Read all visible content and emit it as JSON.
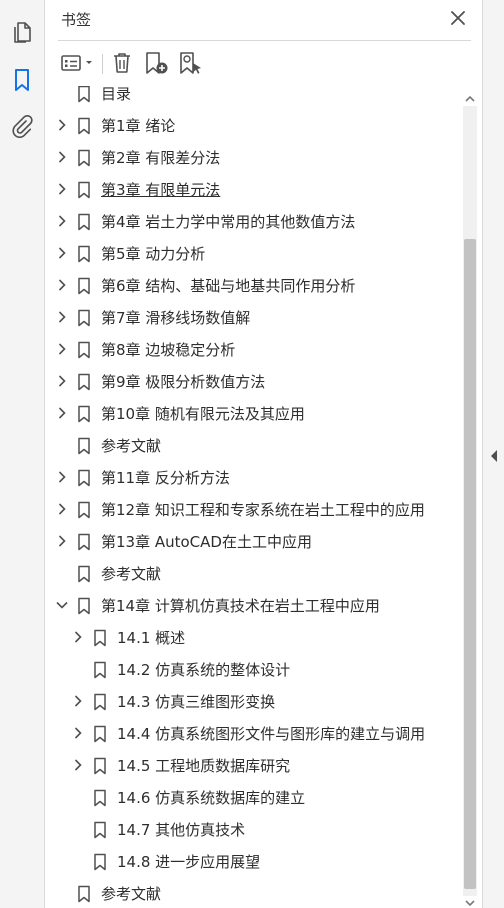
{
  "panel": {
    "title": "书签",
    "close_icon": "close-icon"
  },
  "left_rail": {
    "items": [
      {
        "icon": "pages-icon",
        "active": false
      },
      {
        "icon": "bookmark-icon",
        "active": true
      },
      {
        "icon": "attachment-icon",
        "active": false
      }
    ]
  },
  "toolbar": {
    "options_icon": "list-options-icon",
    "delete_icon": "trash-icon",
    "new_bookmark_icon": "add-bookmark-icon",
    "find_bookmark_icon": "find-bookmark-icon"
  },
  "colors": {
    "accent": "#1473e6",
    "icon_gray": "#505050",
    "scroll_thumb": "#c2c2c2"
  },
  "bookmarks": [
    {
      "label": "目录",
      "level": 0,
      "expander": "none",
      "link": false,
      "partial": true
    },
    {
      "label": "第1章 绪论",
      "level": 0,
      "expander": "collapsed",
      "link": false
    },
    {
      "label": "第2章 有限差分法",
      "level": 0,
      "expander": "collapsed",
      "link": false
    },
    {
      "label": "第3章 有限单元法",
      "level": 0,
      "expander": "collapsed",
      "link": true
    },
    {
      "label": "第4章 岩土力学中常用的其他数值方法",
      "level": 0,
      "expander": "collapsed",
      "link": false
    },
    {
      "label": "第5章 动力分析",
      "level": 0,
      "expander": "collapsed",
      "link": false
    },
    {
      "label": "第6章 结构、基础与地基共同作用分析",
      "level": 0,
      "expander": "collapsed",
      "link": false
    },
    {
      "label": "第7章 滑移线场数值解",
      "level": 0,
      "expander": "collapsed",
      "link": false
    },
    {
      "label": "第8章 边坡稳定分析",
      "level": 0,
      "expander": "collapsed",
      "link": false
    },
    {
      "label": "第9章 极限分析数值方法",
      "level": 0,
      "expander": "collapsed",
      "link": false
    },
    {
      "label": "第10章 随机有限元法及其应用",
      "level": 0,
      "expander": "collapsed",
      "link": false
    },
    {
      "label": "参考文献",
      "level": 0,
      "expander": "none",
      "link": false
    },
    {
      "label": "第11章 反分析方法",
      "level": 0,
      "expander": "collapsed",
      "link": false
    },
    {
      "label": "第12章 知识工程和专家系统在岩土工程中的应用",
      "level": 0,
      "expander": "collapsed",
      "link": false
    },
    {
      "label": "第13章 AutoCAD在土工中应用",
      "level": 0,
      "expander": "collapsed",
      "link": false
    },
    {
      "label": "参考文献",
      "level": 0,
      "expander": "none",
      "link": false
    },
    {
      "label": "第14章 计算机仿真技术在岩土工程中应用",
      "level": 0,
      "expander": "expanded",
      "link": false
    },
    {
      "label": "14.1 概述",
      "level": 1,
      "expander": "collapsed",
      "link": false
    },
    {
      "label": "14.2 仿真系统的整体设计",
      "level": 1,
      "expander": "none",
      "link": false
    },
    {
      "label": "14.3 仿真三维图形变换",
      "level": 1,
      "expander": "collapsed",
      "link": false
    },
    {
      "label": "14.4 仿真系统图形文件与图形库的建立与调用",
      "level": 1,
      "expander": "collapsed",
      "link": false
    },
    {
      "label": "14.5 工程地质数据库研究",
      "level": 1,
      "expander": "collapsed",
      "link": false
    },
    {
      "label": "14.6 仿真系统数据库的建立",
      "level": 1,
      "expander": "none",
      "link": false
    },
    {
      "label": "14.7 其他仿真技术",
      "level": 1,
      "expander": "none",
      "link": false
    },
    {
      "label": "14.8 进一步应用展望",
      "level": 1,
      "expander": "none",
      "link": false
    },
    {
      "label": "参考文献",
      "level": 0,
      "expander": "none",
      "link": false
    }
  ]
}
